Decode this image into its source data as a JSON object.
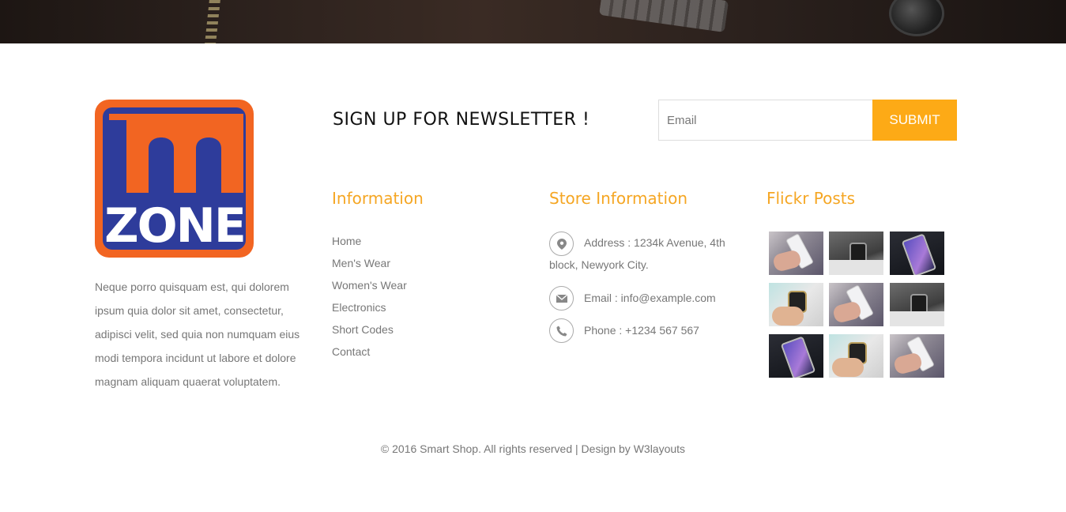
{
  "brand": {
    "logo_top": "m",
    "logo_bottom": "ZONE"
  },
  "about": {
    "text": "Neque porro quisquam est, qui dolorem ipsum quia dolor sit amet, consectetur, adipisci velit, sed quia non numquam eius modi tempora incidunt ut labore et dolore magnam aliquam quaerat voluptatem."
  },
  "newsletter": {
    "title": "SIGN UP FOR NEWSLETTER !",
    "email_placeholder": "Email",
    "submit_label": "SUBMIT"
  },
  "information": {
    "title": "Information",
    "links": [
      "Home",
      "Men's Wear",
      "Women's Wear",
      "Electronics",
      "Short Codes",
      "Contact"
    ]
  },
  "store": {
    "title": "Store Information",
    "address": "Address : 1234k Avenue, 4th block, Newyork City.",
    "email": "Email : info@example.com",
    "phone": "Phone : +1234 567 567"
  },
  "flickr": {
    "title": "Flickr Posts"
  },
  "footer": {
    "copyright": "© 2016 Smart Shop. All rights reserved | Design by W3layouts"
  },
  "colors": {
    "accent": "#fdaa16",
    "heading_accent": "#f5a623",
    "logo_orange": "#f26522",
    "logo_blue": "#2e3c9b"
  },
  "icons": {
    "address": "map-pin-icon",
    "email": "envelope-icon",
    "phone": "phone-icon"
  }
}
